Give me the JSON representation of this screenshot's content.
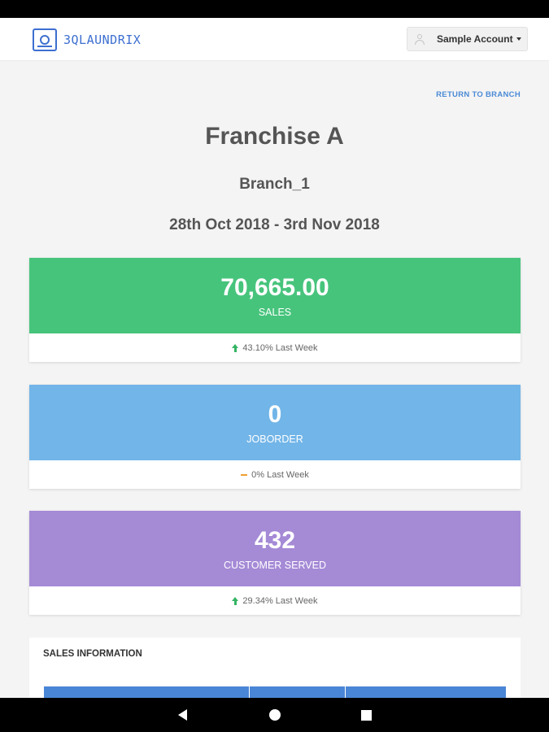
{
  "header": {
    "logo_text": "3QLAUNDRIX",
    "account_label": "Sample Account"
  },
  "return_link": "RETURN TO BRANCH",
  "title": "Franchise A",
  "branch": "Branch_1",
  "date_range": "28th Oct 2018 - 3rd Nov 2018",
  "cards": [
    {
      "value": "70,665.00",
      "label": "SALES",
      "change": "43.10% Last Week",
      "trend": "up",
      "color": "#47c47c"
    },
    {
      "value": "0",
      "label": "JOBORDER",
      "change": "0% Last Week",
      "trend": "flat",
      "color": "#72b5e8"
    },
    {
      "value": "432",
      "label": "CUSTOMER SERVED",
      "change": "29.34% Last Week",
      "trend": "up",
      "color": "#a58ad6"
    }
  ],
  "sales_information": {
    "title": "SALES INFORMATION"
  },
  "colors": {
    "accent_blue": "#4a86d6",
    "trend_up": "#34b464",
    "trend_flat": "#f0a030"
  },
  "nav": {
    "back": "back-icon",
    "home": "home-icon",
    "recent": "recent-apps-icon"
  }
}
